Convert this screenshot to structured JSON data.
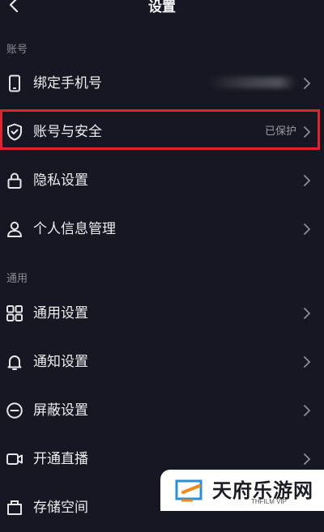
{
  "header": {
    "title": "设置"
  },
  "sections": {
    "account": "账号",
    "general": "通用"
  },
  "rows": [
    {
      "label": "绑定手机号",
      "value": "",
      "icon": "phone-icon"
    },
    {
      "label": "账号与安全",
      "value": "已保护",
      "icon": "shield-icon"
    },
    {
      "label": "隐私设置",
      "value": "",
      "icon": "lock-icon"
    },
    {
      "label": "个人信息管理",
      "value": "",
      "icon": "person-icon"
    },
    {
      "label": "通用设置",
      "value": "",
      "icon": "grid-icon"
    },
    {
      "label": "通知设置",
      "value": "",
      "icon": "bell-icon"
    },
    {
      "label": "屏蔽设置",
      "value": "",
      "icon": "block-icon"
    },
    {
      "label": "开通直播",
      "value": "",
      "icon": "video-icon"
    },
    {
      "label": "存储空间",
      "value": "",
      "icon": "storage-icon"
    }
  ],
  "watermark": {
    "text": "天府乐游网",
    "sub": "THFILM VIP"
  },
  "colors": {
    "highlight": "#e0232d",
    "background": "#161722"
  }
}
